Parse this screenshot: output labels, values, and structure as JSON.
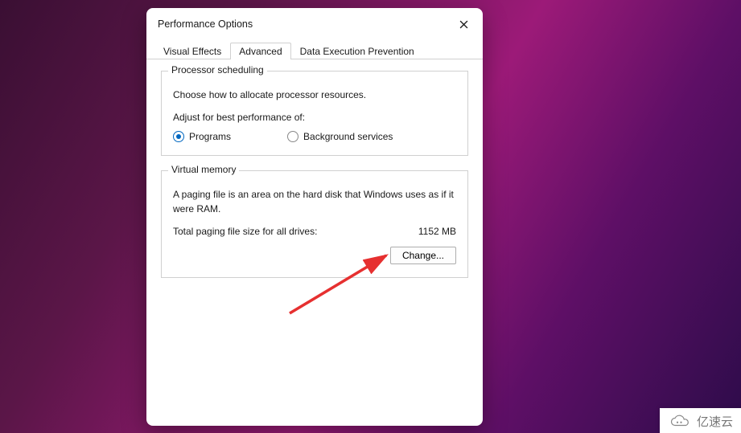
{
  "dialog": {
    "title": "Performance Options",
    "tabs": [
      {
        "label": "Visual Effects",
        "active": false
      },
      {
        "label": "Advanced",
        "active": true
      },
      {
        "label": "Data Execution Prevention",
        "active": false
      }
    ]
  },
  "processor": {
    "legend": "Processor scheduling",
    "desc": "Choose how to allocate processor resources.",
    "subhead": "Adjust for best performance of:",
    "options": {
      "programs": "Programs",
      "background": "Background services"
    },
    "selected": "programs"
  },
  "virtual_memory": {
    "legend": "Virtual memory",
    "desc": "A paging file is an area on the hard disk that Windows uses as if it were RAM.",
    "total_label": "Total paging file size for all drives:",
    "total_value": "1152 MB",
    "change_label": "Change..."
  },
  "watermark": "亿速云"
}
